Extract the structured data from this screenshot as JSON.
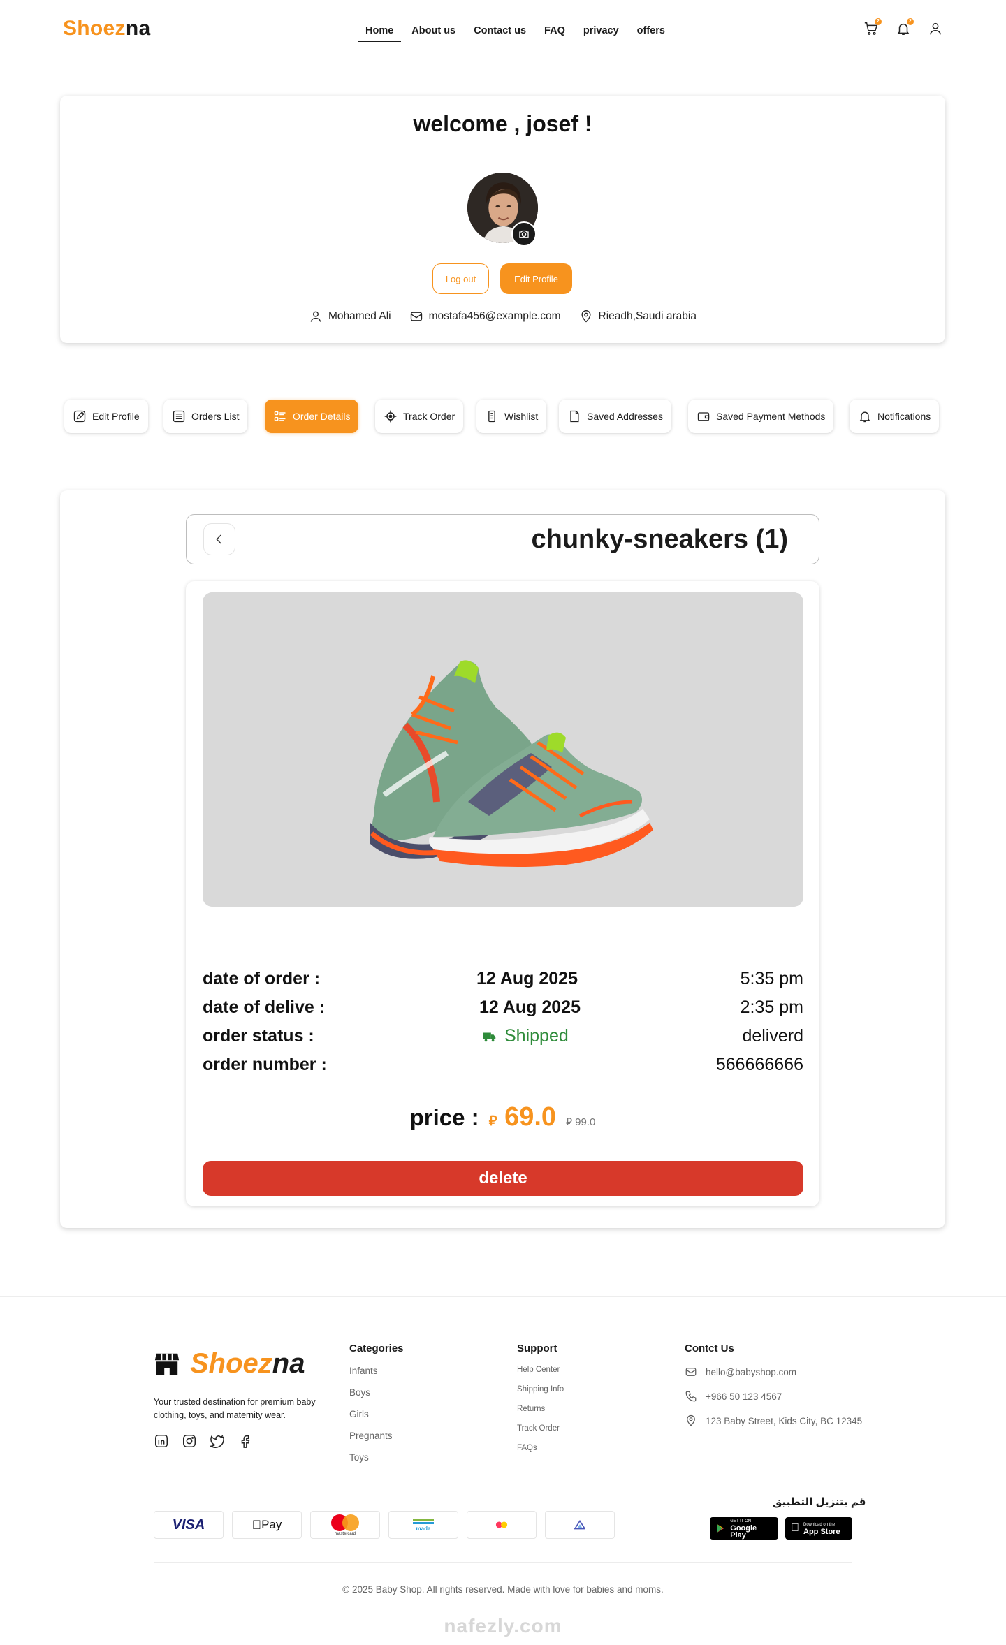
{
  "header": {
    "logo_a": "Shoez",
    "logo_b": "na",
    "nav": [
      "Home",
      "About us",
      "Contact us",
      "FAQ",
      "privacy",
      "offers"
    ],
    "cart_badge": "2",
    "bell_badge": "2"
  },
  "profile": {
    "welcome": "welcome , josef !",
    "logout_label": "Log out",
    "edit_label": "Edit Profile",
    "name": "Mohamed Ali",
    "email": "mostafa456@example.com",
    "location": "Rieadh,Saudi arabia"
  },
  "tabs": [
    "Edit Profile",
    "Orders List",
    "Order Details",
    "Track Order",
    "Wishlist",
    "Saved Addresses",
    "Saved Payment Methods",
    "Notifications"
  ],
  "active_tab": "Order Details",
  "order": {
    "title": "chunky-sneakers (1)",
    "date_of_order_label": "date of order :",
    "date_of_order": "12 Aug 2025",
    "time_of_order": "5:35 pm",
    "date_of_delivery_label": "date of delive :",
    "date_of_delivery": "12 Aug 2025",
    "time_of_delivery": "2:35 pm",
    "status_label": "order status :",
    "status": "Shipped",
    "status_right": "deliverd",
    "number_label": "order number :",
    "number": "566666666",
    "price_label": "price :",
    "price": "69.0",
    "old_price": "99.0",
    "currency": "⃁",
    "delete_label": "delete"
  },
  "footer": {
    "logo_a": "Shoez",
    "logo_b": "na",
    "tagline": "Your trusted destination for premium baby clothing, toys, and maternity wear.",
    "categories_title": "Categories",
    "categories": [
      "Infants",
      "Boys",
      "Girls",
      "Pregnants",
      "Toys"
    ],
    "support_title": "Support",
    "support": [
      "Help Center",
      "Shipping Info",
      "Returns",
      "Track Order",
      "FAQs"
    ],
    "contact_title": "Contct Us",
    "email": "hello@babyshop.com",
    "phone": "+966 50 123 4567",
    "address": "123 Baby Street, Kids City, BC 12345",
    "app_title": "قم بتنزيل التطبيق",
    "google_small": "GET IT ON",
    "google_main": "Google Play",
    "apple_small": "Download on the",
    "apple_main": "App Store",
    "payments": [
      "VISA",
      "Pay",
      "mastercard",
      "mada"
    ],
    "copyright": "© 2025 Baby Shop. All rights reserved. Made with love for babies and moms.",
    "watermark": "nafezly.com"
  },
  "colors": {
    "accent": "#F7931E",
    "danger": "#D7392A",
    "success": "#2E8B3A"
  }
}
